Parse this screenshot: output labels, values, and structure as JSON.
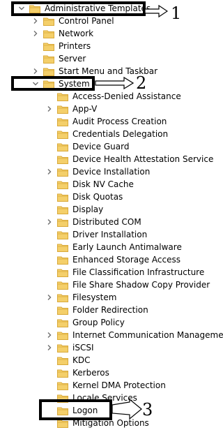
{
  "tree": {
    "items": [
      {
        "label": "Administrative Templates",
        "expander": "expanded",
        "level": 0
      },
      {
        "label": "Control Panel",
        "expander": "collapsed",
        "level": 1
      },
      {
        "label": "Network",
        "expander": "collapsed",
        "level": 1
      },
      {
        "label": "Printers",
        "expander": "none",
        "level": 1
      },
      {
        "label": "Server",
        "expander": "none",
        "level": 1
      },
      {
        "label": "Start Menu and Taskbar",
        "expander": "collapsed",
        "level": 1
      },
      {
        "label": "System",
        "expander": "expanded",
        "level": 1
      },
      {
        "label": "Access-Denied Assistance",
        "expander": "none",
        "level": 2
      },
      {
        "label": "App-V",
        "expander": "collapsed",
        "level": 2
      },
      {
        "label": "Audit Process Creation",
        "expander": "none",
        "level": 2
      },
      {
        "label": "Credentials Delegation",
        "expander": "none",
        "level": 2
      },
      {
        "label": "Device Guard",
        "expander": "none",
        "level": 2
      },
      {
        "label": "Device Health Attestation Service",
        "expander": "none",
        "level": 2
      },
      {
        "label": "Device Installation",
        "expander": "collapsed",
        "level": 2
      },
      {
        "label": "Disk NV Cache",
        "expander": "none",
        "level": 2
      },
      {
        "label": "Disk Quotas",
        "expander": "none",
        "level": 2
      },
      {
        "label": "Display",
        "expander": "none",
        "level": 2
      },
      {
        "label": "Distributed COM",
        "expander": "collapsed",
        "level": 2
      },
      {
        "label": "Driver Installation",
        "expander": "none",
        "level": 2
      },
      {
        "label": "Early Launch Antimalware",
        "expander": "none",
        "level": 2
      },
      {
        "label": "Enhanced Storage Access",
        "expander": "none",
        "level": 2
      },
      {
        "label": "File Classification Infrastructure",
        "expander": "none",
        "level": 2
      },
      {
        "label": "File Share Shadow Copy Provider",
        "expander": "none",
        "level": 2
      },
      {
        "label": "Filesystem",
        "expander": "collapsed",
        "level": 2
      },
      {
        "label": "Folder Redirection",
        "expander": "none",
        "level": 2
      },
      {
        "label": "Group Policy",
        "expander": "none",
        "level": 2
      },
      {
        "label": "Internet Communication Managemer",
        "expander": "collapsed",
        "level": 2
      },
      {
        "label": "iSCSI",
        "expander": "collapsed",
        "level": 2
      },
      {
        "label": "KDC",
        "expander": "none",
        "level": 2
      },
      {
        "label": "Kerberos",
        "expander": "none",
        "level": 2
      },
      {
        "label": "Kernel DMA Protection",
        "expander": "none",
        "level": 2
      },
      {
        "label": "Locale Services",
        "expander": "none",
        "level": 2
      },
      {
        "label": "Logon",
        "expander": "none",
        "level": 2
      },
      {
        "label": "Mitigation Options",
        "expander": "none",
        "level": 2
      }
    ]
  },
  "annotations": [
    {
      "number": "1"
    },
    {
      "number": "2"
    },
    {
      "number": "3"
    }
  ],
  "colors": {
    "folder_fill": "#f4cf6a",
    "folder_edge": "#d9a93a",
    "chevron": "#6f6f6f",
    "box": "#000000"
  }
}
